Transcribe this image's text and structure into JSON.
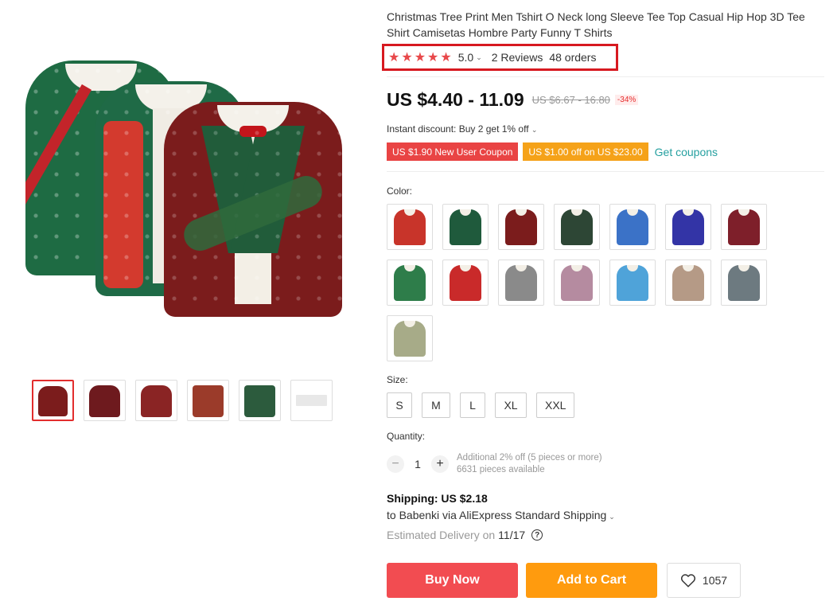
{
  "product": {
    "title": "Christmas Tree Print Men Tshirt O Neck long Sleeve Tee Top Casual Hip Hop 3D Tee Shirt Camisetas Hombre Party Funny T Shirts",
    "rating_value": "5.0",
    "stars": 5,
    "reviews_label": "2 Reviews",
    "orders_label": "48 orders"
  },
  "price": {
    "current": "US $4.40 - 11.09",
    "original": "US $6.67 - 16.80",
    "discount": "-34%"
  },
  "promo": {
    "instant_discount": "Instant discount: Buy 2 get 1% off",
    "coupons": [
      {
        "label": "US $1.90 New User Coupon",
        "color": "#e94444"
      },
      {
        "label": "US $1.00 off on US $23.00",
        "color": "#f5a219"
      }
    ],
    "get_coupons_label": "Get coupons"
  },
  "color": {
    "label": "Color:",
    "swatches": [
      {
        "name": "red-tie-print",
        "color": "#c8342a"
      },
      {
        "name": "green-tuxedo-print",
        "color": "#1f5a3c"
      },
      {
        "name": "burgundy-tuxedo-print",
        "color": "#7b1c1c"
      },
      {
        "name": "dark-christmas-knit",
        "color": "#2d4635"
      },
      {
        "name": "blue-snowman",
        "color": "#3b72c7"
      },
      {
        "name": "navy-reindeer",
        "color": "#3334a6"
      },
      {
        "name": "maroon-santa",
        "color": "#7e1f2a"
      },
      {
        "name": "green-white-knit",
        "color": "#2e7d4a"
      },
      {
        "name": "santa-suit",
        "color": "#c92a2a"
      },
      {
        "name": "grey-heather",
        "color": "#8a8a8a"
      },
      {
        "name": "pink-heather",
        "color": "#b58ba0"
      },
      {
        "name": "sky-blue",
        "color": "#4fa3d9"
      },
      {
        "name": "beige-heather",
        "color": "#b59a86"
      },
      {
        "name": "slate-heather",
        "color": "#6d7a80"
      },
      {
        "name": "khaki-green",
        "color": "#a7ab88"
      }
    ]
  },
  "size": {
    "label": "Size:",
    "options": [
      "S",
      "M",
      "L",
      "XL",
      "XXL"
    ]
  },
  "quantity": {
    "label": "Quantity:",
    "value": "1",
    "note_line1": "Additional 2% off (5 pieces or more)",
    "note_line2": "6631 pieces available"
  },
  "shipping": {
    "title": "Shipping: US $2.18",
    "via": "to Babenki via AliExpress Standard Shipping",
    "estimated_label": "Estimated Delivery on",
    "estimated_date": "11/17"
  },
  "actions": {
    "buy_now": "Buy Now",
    "add_to_cart": "Add to Cart",
    "wishlist_count": "1057"
  },
  "gallery": {
    "thumbnails": [
      {
        "name": "thumb-group",
        "color": "#7b1c1c"
      },
      {
        "name": "thumb-burgundy-front",
        "color": "#6e1a1e"
      },
      {
        "name": "thumb-burgundy-flat",
        "color": "#8a2424"
      },
      {
        "name": "thumb-sleeve-detail",
        "color": "#9b3b2a"
      },
      {
        "name": "thumb-collar-detail",
        "color": "#2c5b3d"
      },
      {
        "name": "thumb-size-chart",
        "color": "#bdbdbd"
      }
    ]
  }
}
